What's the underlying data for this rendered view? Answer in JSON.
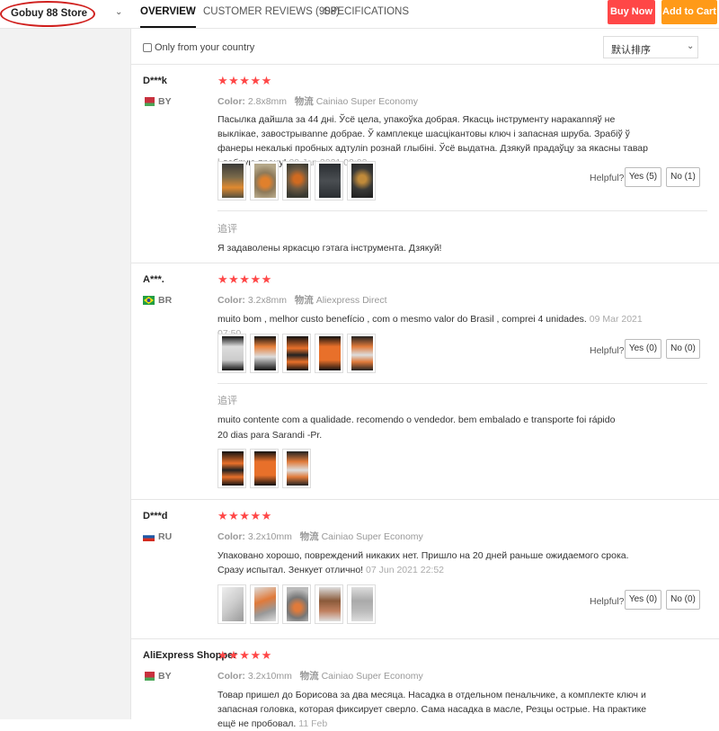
{
  "store": {
    "name": "Gobuy 88 Store",
    "chevron_icon": "chevron-down-icon"
  },
  "tabs": [
    {
      "label": "OVERVIEW",
      "active": true
    },
    {
      "label": "CUSTOMER REVIEWS (908)",
      "active": false
    },
    {
      "label": "SPECIFICATIONS",
      "active": false
    }
  ],
  "actions": {
    "buy_now": "Buy Now",
    "add_to_cart": "Add to Cart",
    "buy_color": "#ff4747",
    "cart_color": "#ff9a18"
  },
  "filter": {
    "only_country_label": "Only from your country",
    "only_country_checked": false,
    "sort_value": "默认排序"
  },
  "reviews": [
    {
      "name": "D***k",
      "country": "BY",
      "flag": "belarus-flag-icon",
      "rating": 5,
      "stars": "★★★★★",
      "color_label": "Color:",
      "color_value": "2.8x8mm",
      "shipping_label": "物流",
      "shipping_value": "Cainiao Super Economy",
      "text": "Пасылка дайшла за 44 дні. Ўсё цела, упакоўка добрая. Якасць інструменту наракannяў не выклікае, завострываnne добрае. Ў камплекце шасцікантовы ключ і запасная шруба. Зрабіў ў фанеры некалькі пробных адтуліn рознай глыбіні. Ўсё выдатна. Дзякуй прадаўцу за якасны тавар і добрую працу!",
      "date": "29 Jan 2021 02:02",
      "helpful_label": "Helpful?",
      "yes": "Yes (5)",
      "no": "No (1)",
      "followup_label": "追评",
      "followup_text": "Я задаволены яркасцю гэтага інструмента. Дзякуй!"
    },
    {
      "name": "A***.",
      "country": "BR",
      "flag": "brazil-flag-icon",
      "rating": 5,
      "stars": "★★★★★",
      "color_label": "Color:",
      "color_value": "3.2x8mm",
      "shipping_label": "物流",
      "shipping_value": "Aliexpress Direct",
      "text": "muito bom , melhor custo benefício , com o mesmo valor do Brasil , comprei 4 unidades.",
      "date": "09 Mar 2021 07:50",
      "helpful_label": "Helpful?",
      "yes": "Yes (0)",
      "no": "No (0)",
      "followup_label": "追评",
      "followup_text": "muito contente com a qualidade. recomendo o vendedor. bem embalado e transporte foi rápido 20 dias para Sarandi -Pr."
    },
    {
      "name": "D***d",
      "country": "RU",
      "flag": "russia-flag-icon",
      "rating": 5,
      "stars": "★★★★★",
      "color_label": "Color:",
      "color_value": "3.2x10mm",
      "shipping_label": "物流",
      "shipping_value": "Cainiao Super Economy",
      "text": "Упаковано хорошо, повреждений никаких нет. Пришло на 20 дней раньше ожидаемого срока. Сразу испытал. Зенкует отлично!",
      "date": "07 Jun 2021 22:52",
      "helpful_label": "Helpful?",
      "yes": "Yes (0)",
      "no": "No (0)"
    },
    {
      "name": "AliExpress Shopper",
      "country": "BY",
      "flag": "belarus-flag-icon",
      "rating": 5,
      "stars": "★★★★★",
      "color_label": "Color:",
      "color_value": "3.2x10mm",
      "shipping_label": "物流",
      "shipping_value": "Cainiao Super Economy",
      "text": "Товар пришел до Борисова за два месяца. Насадка в отдельном пенальчике, а комплекте ключ и запасная головка, которая фиксирует сверло. Сама насадка в масле, Резцы острые. На практике ещё не пробовал.",
      "date": "11 Feb"
    }
  ]
}
